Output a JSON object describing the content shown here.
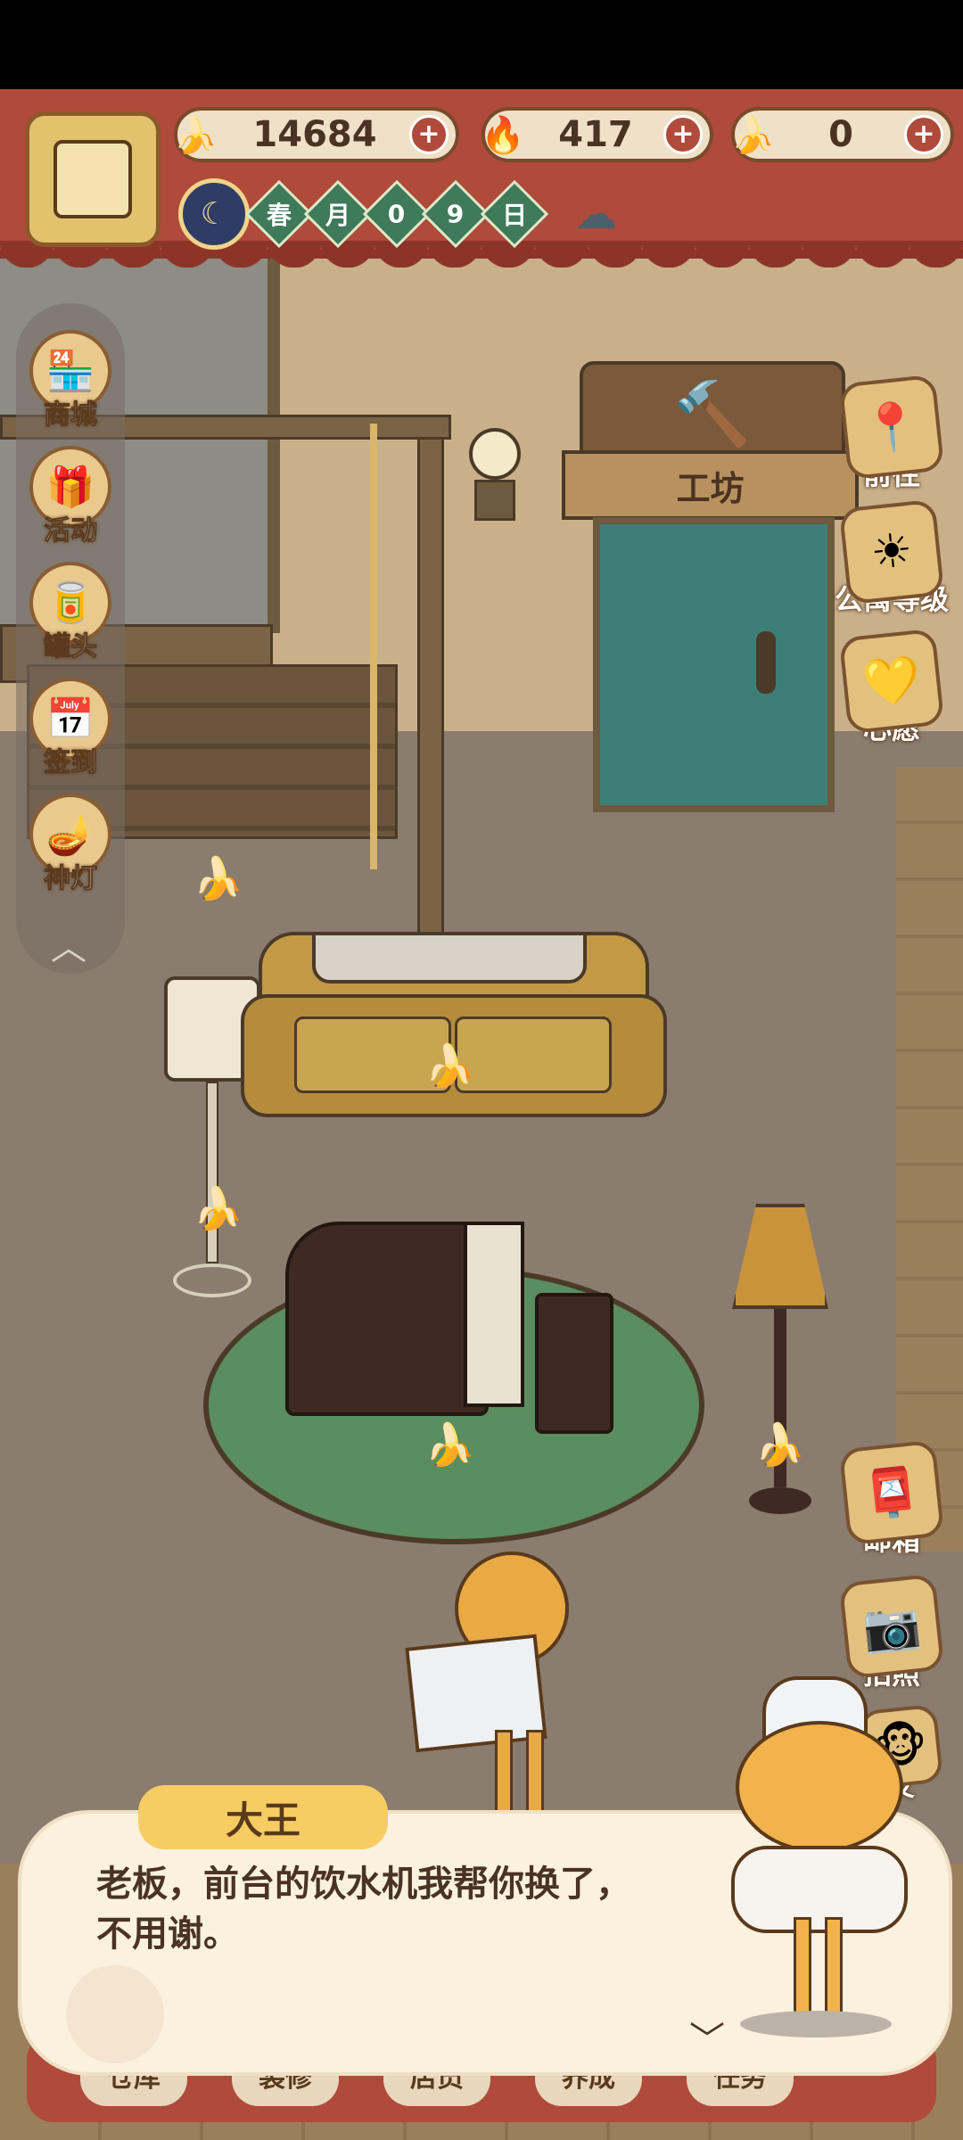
{
  "currencies": {
    "banana": {
      "value": "14684",
      "icon": "banana-icon"
    },
    "flame": {
      "value": "417",
      "icon": "blue-flame-icon"
    },
    "blue_banana": {
      "value": "0",
      "icon": "blue-banana-icon"
    }
  },
  "date": {
    "season": "春",
    "month_label": "月",
    "day_digits": [
      "0",
      "9"
    ],
    "day_label": "日",
    "weather_icon": "rain-cloud-icon"
  },
  "left_menu": [
    {
      "label": "商城",
      "icon": "shop-icon"
    },
    {
      "label": "活动",
      "icon": "gift-icon"
    },
    {
      "label": "罐头",
      "icon": "can-icon"
    },
    {
      "label": "签到",
      "icon": "calendar-icon"
    },
    {
      "label": "神灯",
      "icon": "magic-lamp-icon"
    }
  ],
  "right_menu_top": [
    {
      "label": "前往",
      "icon": "map-pin-icon"
    },
    {
      "label": "公寓等级",
      "icon": "sun-badge-icon"
    },
    {
      "label": "心愿",
      "icon": "heart-book-icon"
    }
  ],
  "right_menu_bottom": [
    {
      "label": "邮箱",
      "icon": "mailbox-icon"
    },
    {
      "label": "拍照",
      "icon": "camera-icon"
    },
    {
      "label": "友",
      "icon": "friend-icon"
    }
  ],
  "workshop": {
    "sign": "工坊"
  },
  "dialog": {
    "speaker": "大王",
    "line1": "老板，前台的饮水机我帮你换了，",
    "line2": "不用谢。"
  },
  "bottom_bar": [
    "仓库",
    "装修",
    "店员",
    "养成",
    "任务"
  ],
  "colors": {
    "header_red": "#b04a3a",
    "cream": "#fbf1df",
    "speaker_yellow": "#f7cc63",
    "text_brown": "#4a3322"
  }
}
